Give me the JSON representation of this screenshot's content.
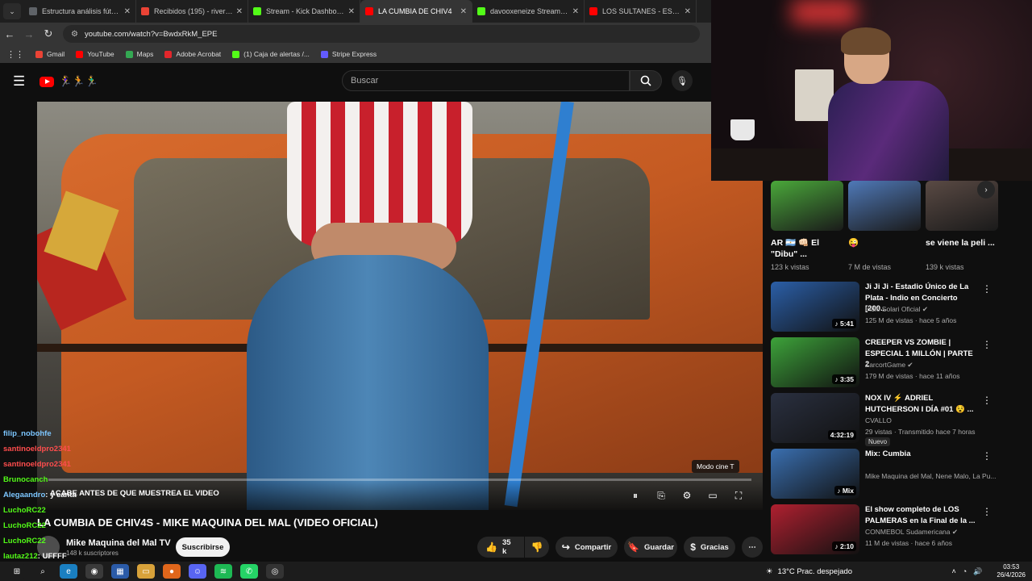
{
  "browser": {
    "tabs": [
      {
        "label": "Estructura análisis fútbol",
        "color": "#5f6368"
      },
      {
        "label": "Recibidos (195) - riverunir",
        "color": "#ea4335"
      },
      {
        "label": "Stream - Kick Dashboard",
        "color": "#53fc18"
      },
      {
        "label": "LA CUMBIA DE CHIV4",
        "color": "#ff0000",
        "active": true
      },
      {
        "label": "davooxeneize Stream - W",
        "color": "#53fc18"
      },
      {
        "label": "LOS SULTANES - ESTOY S",
        "color": "#ff0000"
      }
    ],
    "url": "youtube.com/watch?v=BwdxRkM_EPE",
    "bookmarks": [
      {
        "label": "Gmail",
        "color": "#ea4335"
      },
      {
        "label": "YouTube",
        "color": "#ff0000"
      },
      {
        "label": "Maps",
        "color": "#34a853"
      },
      {
        "label": "Adobe Acrobat",
        "color": "#e3262b"
      },
      {
        "label": "(1) Caja de alertas /...",
        "color": "#53fc18"
      },
      {
        "label": "Stripe Express",
        "color": "#635bff"
      }
    ]
  },
  "youtube": {
    "search_placeholder": "Buscar",
    "doodle": "🏃‍♀️🏃🏃‍♂️",
    "player": {
      "caption": "ACABE ANTES DE QUE MUESTREA EL VIDEO",
      "mode_tooltip": "Modo cine  T",
      "progress": 0.0
    },
    "video_title": "LA CUMBIA DE CHIV4S - MIKE MAQUINA DEL MAL (VIDEO OFICIAL)",
    "channel": {
      "name": "Mike Maquina del Mal TV",
      "subs": "148 k suscriptores"
    },
    "subscribe_label": "Suscribirse",
    "actions": {
      "likes": "35 k",
      "share": "Compartir",
      "save": "Guardar",
      "thanks": "Gracias"
    }
  },
  "chat": [
    {
      "user": "filip_nobohfe",
      "msg": "",
      "color": "blue"
    },
    {
      "user": "santinoeldpro2341",
      "msg": "",
      "color": "red"
    },
    {
      "user": "santinoeldpro2341",
      "msg": "",
      "color": "red"
    },
    {
      "user": "Brunocanch",
      "msg": "",
      "color": "green"
    },
    {
      "user": "Alegaandro",
      "msg": ": y canta",
      "color": "blue"
    },
    {
      "user": "LuchoRC22",
      "msg": "",
      "color": "green"
    },
    {
      "user": "LuchoRC22",
      "msg": "",
      "color": "green"
    },
    {
      "user": "LuchoRC22",
      "msg": "",
      "color": "green"
    },
    {
      "user": "lautaz212",
      "msg": ": UFFFF",
      "color": "green"
    }
  ],
  "sidebar": {
    "shorts": [
      {
        "title": "AR 🇦🇷 👊🏻 El \"Dibu\" ...",
        "views": "123 k vistas",
        "color": "#4aa83a"
      },
      {
        "title": "😜",
        "views": "7 M de vistas",
        "color": "#4f79b8"
      },
      {
        "title": "se viene la peli ...",
        "views": "139 k vistas",
        "color": "#5a4a44"
      }
    ],
    "recs": [
      {
        "title": "Ji Ji Ji - Estadio Único de La Plata - Indio en Concierto [200...",
        "channel": "Indio Solari Oficial ✔",
        "meta": "125 M de vistas · hace 5 años",
        "duration": "♪ 5:41",
        "color": "#2b5fa8"
      },
      {
        "title": "CREEPER VS ZOMBIE | ESPECIAL 1 MILLÓN | PARTE 2",
        "channel": "ZarcortGame ✔",
        "meta": "179 M de vistas · hace 11 años",
        "duration": "♪ 3:35",
        "color": "#3da33a"
      },
      {
        "title": "NOX IV ⚡ ADRIEL HUTCHERSON I DÍA #01 😵 ...",
        "channel": "CVALLO",
        "meta": "29 vistas · Transmitido hace 7 horas",
        "duration": "4:32:19",
        "badge": "Nuevo",
        "color": "#2a3040"
      },
      {
        "title": "Mix: Cumbia",
        "channel": "Mike Maquina del Mal, Nene Malo, La Pu...",
        "meta": "",
        "duration": "♪ Mix",
        "color": "#3a6fb0"
      },
      {
        "title": "El show completo de LOS PALMERAS en la Final de la ...",
        "channel": "CONMEBOL Sudamericana ✔",
        "meta": "11 M de vistas · hace 6 años",
        "duration": "♪ 2:10",
        "color": "#b02030"
      }
    ]
  },
  "taskbar": {
    "weather": "13°C  Prac. despejado",
    "time": "03:53",
    "date": "26/4/2026"
  }
}
